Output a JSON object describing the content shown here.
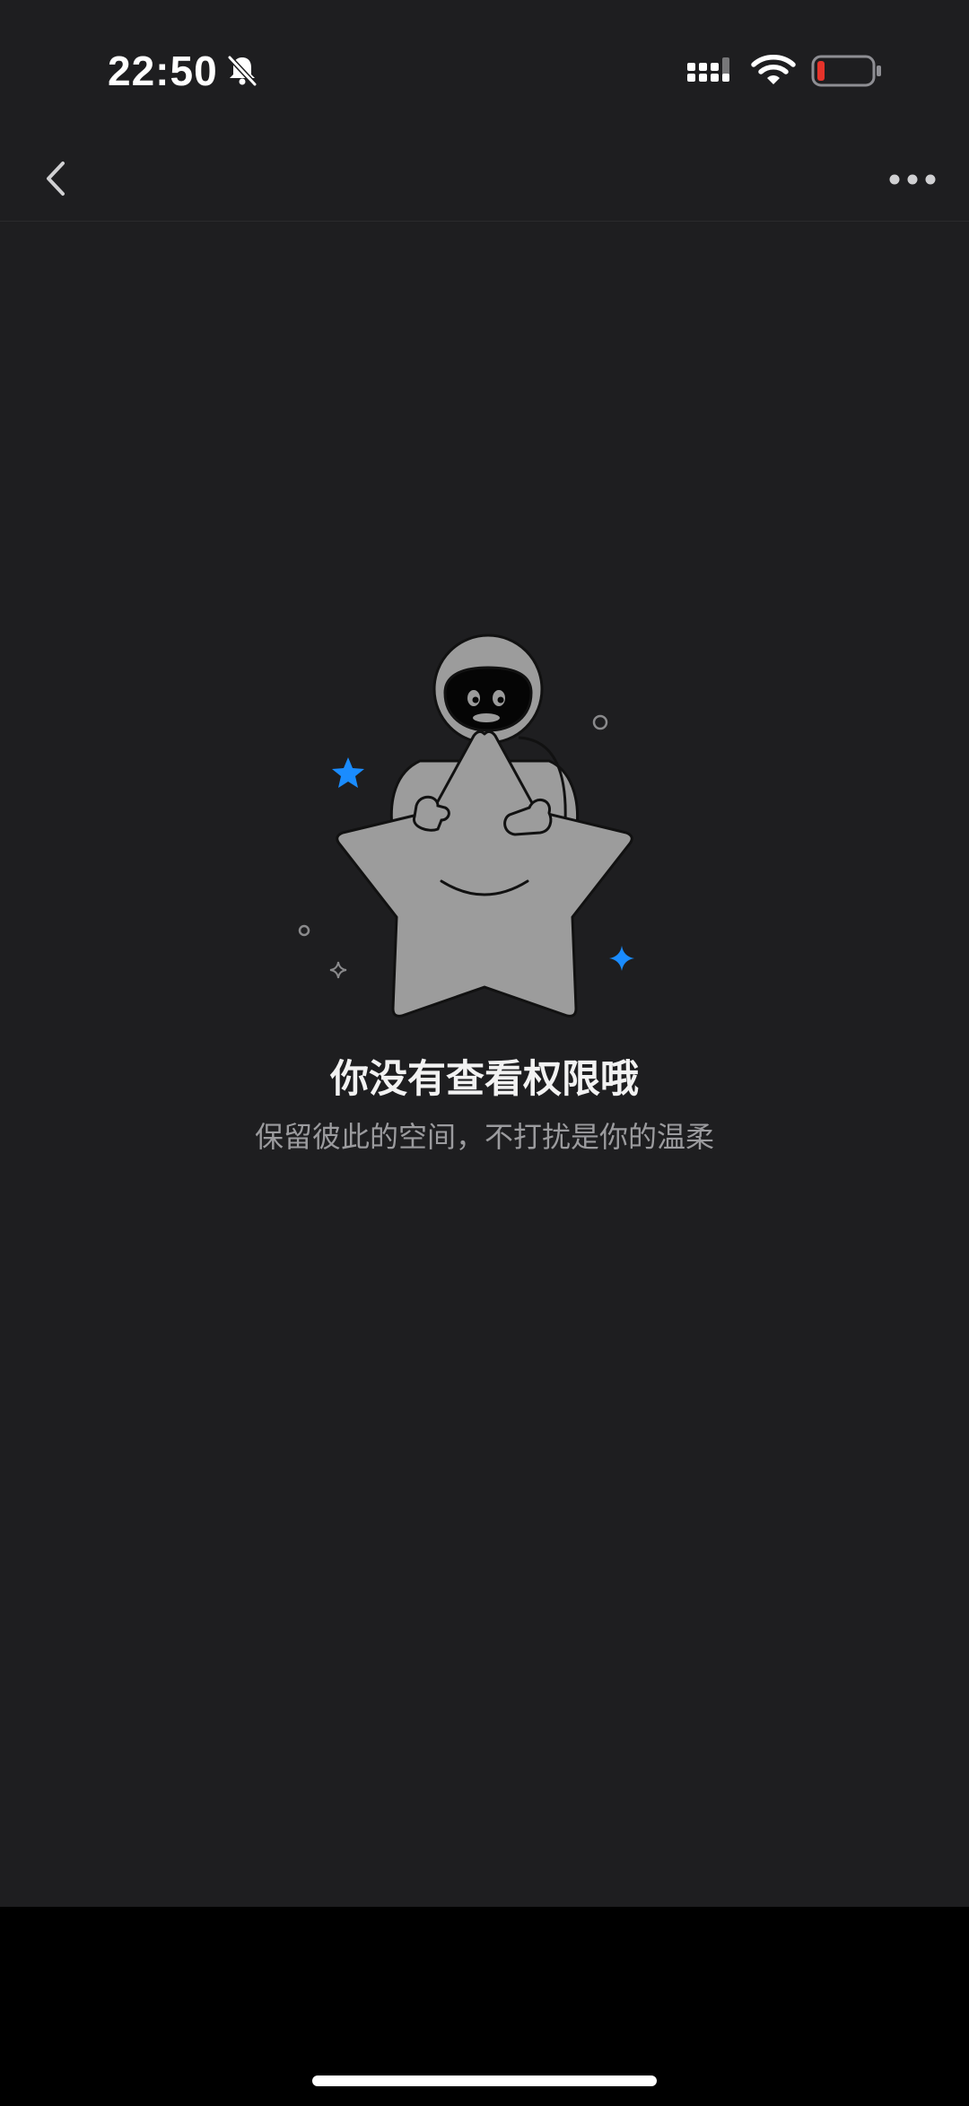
{
  "status_bar": {
    "time": "22:50",
    "icons": [
      "bell-slash-icon",
      "cellular-signal-icon",
      "wifi-icon",
      "battery-low-icon"
    ],
    "battery_color": "#e5332a"
  },
  "nav": {
    "title": "",
    "back_icon": "chevron-left-icon",
    "more_icon": "ellipsis-icon"
  },
  "empty_state": {
    "illustration": "astronaut-hugging-star",
    "title": "你没有查看权限哦",
    "subtitle": "保留彼此的空间，不打扰是你的温柔",
    "accent_color": "#1a8cff"
  },
  "colors": {
    "background": "#1e1e20",
    "bottom_bar": "#000000",
    "title_text": "#f2f2f2",
    "subtitle_text": "#9b9b9e"
  }
}
